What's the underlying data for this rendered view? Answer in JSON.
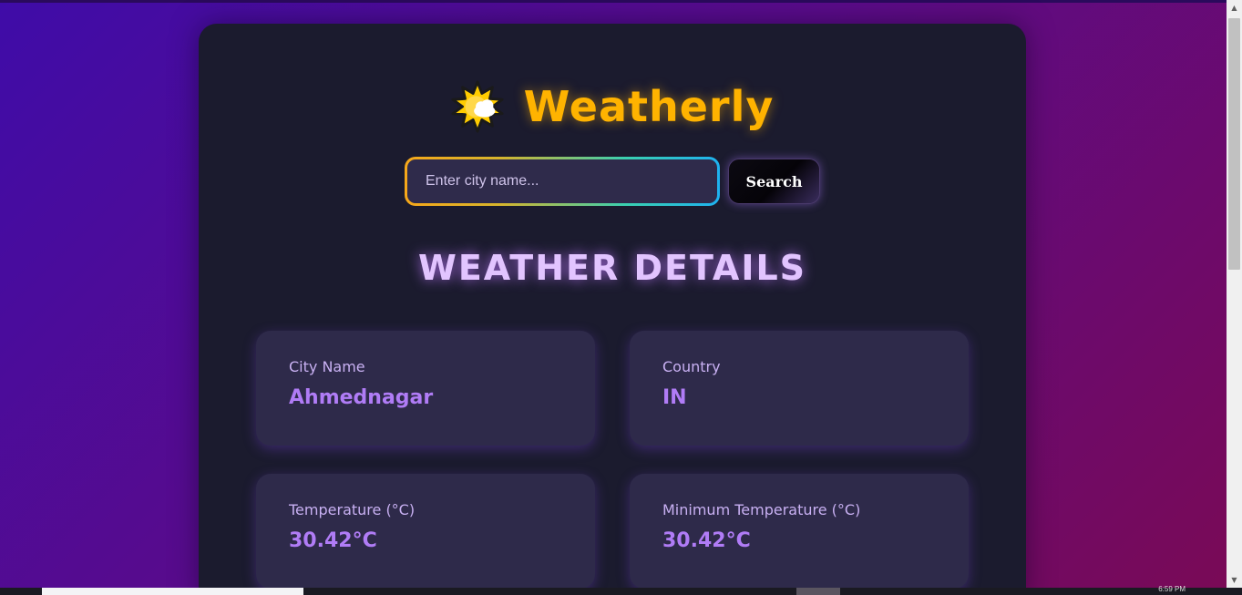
{
  "app": {
    "title": "Weatherly",
    "logo_icon": "sun-behind-cloud-icon"
  },
  "search": {
    "placeholder": "Enter city name...",
    "value": "",
    "button_label": "Search"
  },
  "section": {
    "title": "WEATHER DETAILS"
  },
  "details": [
    {
      "label": "City Name",
      "value": "Ahmednagar"
    },
    {
      "label": "Country",
      "value": "IN"
    },
    {
      "label": "Temperature (°C)",
      "value": "30.42°C"
    },
    {
      "label": "Minimum Temperature (°C)",
      "value": "30.42°C"
    }
  ],
  "colors": {
    "brand": "#ffb300",
    "accent": "#b07cf6",
    "card_bg": "#1b1b2e",
    "tile_bg": "#2e2a4a"
  },
  "taskbar": {
    "clock": "6:59 PM"
  }
}
